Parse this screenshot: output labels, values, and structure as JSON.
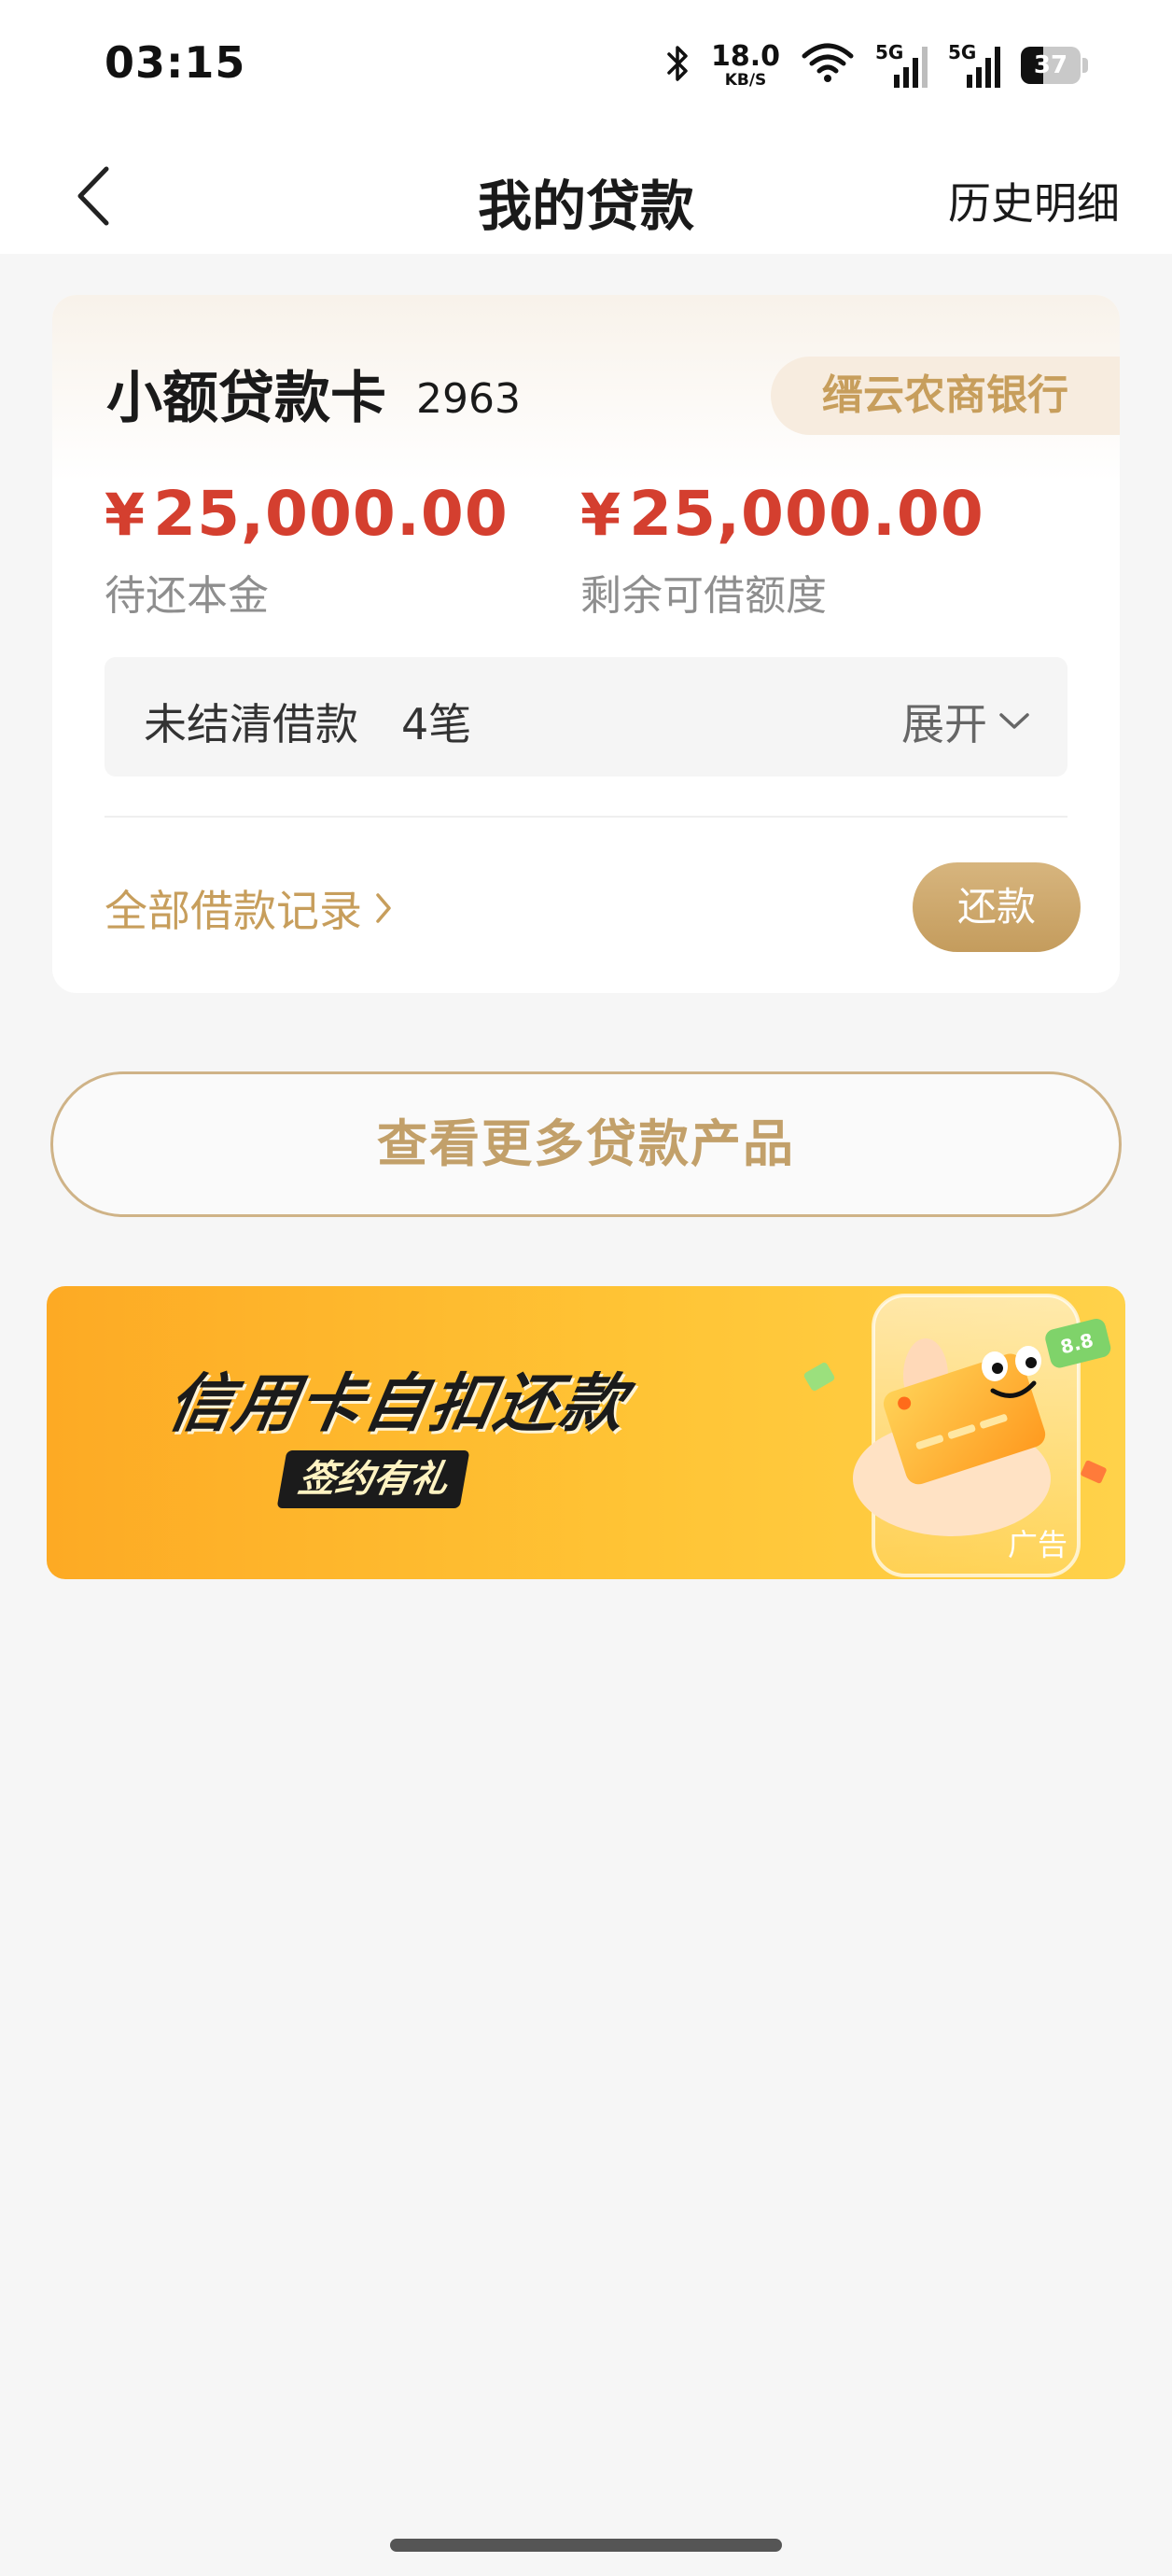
{
  "status_bar": {
    "time": "03:15",
    "net_speed_value": "18.0",
    "net_speed_unit": "KB/S",
    "signal_1_label": "5G",
    "signal_2_label": "5G",
    "battery_level": "37"
  },
  "nav": {
    "title": "我的贷款",
    "history_link": "历史明细"
  },
  "loan_card": {
    "name": "小额贷款卡",
    "card_suffix": "2963",
    "bank": "缙云农商银行",
    "currency_symbol": "¥",
    "principal_amount": "25,000.00",
    "principal_label": "待还本金",
    "available_amount": "25,000.00",
    "available_label": "剩余可借额度",
    "outstanding_label": "未结清借款",
    "outstanding_count": "4笔",
    "expand_label": "展开",
    "all_records_label": "全部借款记录",
    "repay_button": "还款"
  },
  "more_products_button": "查看更多贷款产品",
  "banner": {
    "title": "信用卡自扣还款",
    "subtitle": "签约有礼",
    "ad_label": "广告",
    "card_badge": "8.8"
  },
  "colors": {
    "accent_gold": "#c79e5c",
    "amount_red": "#d43f2f",
    "banner_orange": "#ffbe30"
  }
}
